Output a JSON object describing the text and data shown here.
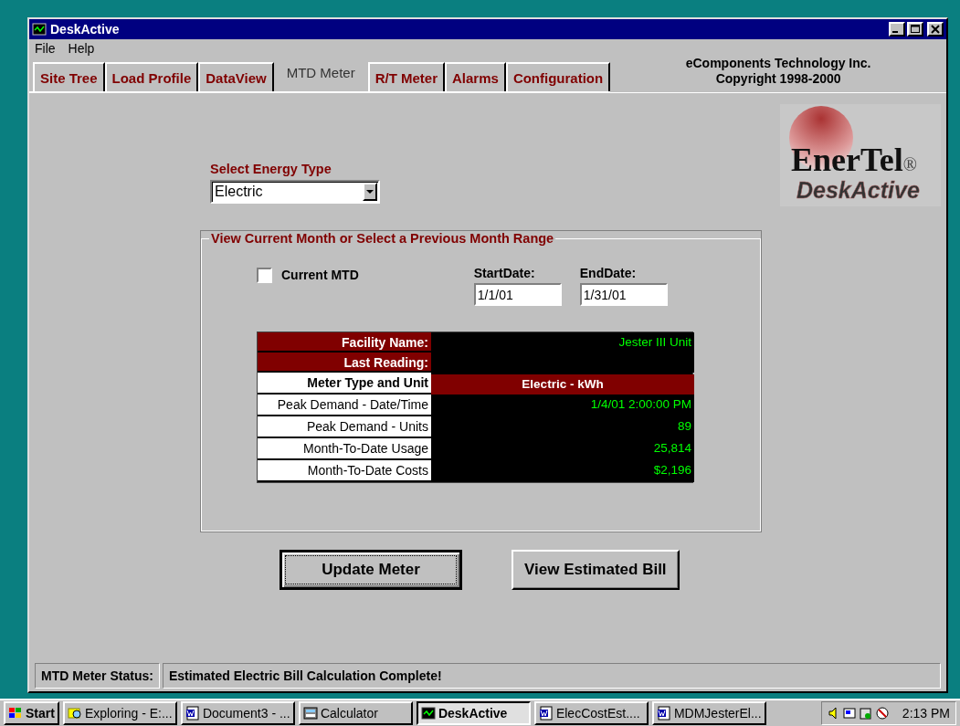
{
  "window": {
    "title": "DeskActive"
  },
  "menu": [
    "File",
    "Help"
  ],
  "tabs": [
    {
      "label": "Site Tree",
      "selected": false
    },
    {
      "label": "Load Profile",
      "selected": false
    },
    {
      "label": "DataView",
      "selected": false
    },
    {
      "label": "MTD Meter",
      "selected": true
    },
    {
      "label": "R/T Meter",
      "selected": false
    },
    {
      "label": "Alarms",
      "selected": false
    },
    {
      "label": "Configuration",
      "selected": false
    }
  ],
  "company": [
    "eComponents Technology Inc.",
    "Copyright 1998-2000"
  ],
  "logo": {
    "name": "EnerTel",
    "mark": "®",
    "product": "DeskActive"
  },
  "energy_type": {
    "label": "Select Energy Type",
    "value": "Electric"
  },
  "range": {
    "title": "View Current Month or Select a Previous Month Range",
    "current_mtd": {
      "label": "Current MTD",
      "checked": false
    },
    "start_date": {
      "label": "StartDate:",
      "value": "1/1/01"
    },
    "end_date": {
      "label": "EndDate:",
      "value": "1/31/01"
    }
  },
  "table": [
    {
      "kind": "header",
      "label": "Facility Name:",
      "value": "Jester III Unit"
    },
    {
      "kind": "header",
      "label": "Last Reading:"
    },
    {
      "kind": "type",
      "label": "Meter Type and Unit",
      "value": "Electric - kWh"
    },
    {
      "kind": "plain",
      "label": "Peak Demand - Date/Time",
      "value": "1/4/01 2:00:00 PM"
    },
    {
      "kind": "plain",
      "label": "Peak Demand - Units",
      "value": "89"
    },
    {
      "kind": "plain",
      "label": "Month-To-Date Usage",
      "value": "25,814"
    },
    {
      "kind": "plain",
      "label": "Month-To-Date Costs",
      "value": "$2,196"
    }
  ],
  "buttons": [
    {
      "label": "Update Meter",
      "focused": true
    },
    {
      "label": "View Estimated Bill",
      "focused": false
    }
  ],
  "status_bar": {
    "label": "MTD Meter Status:",
    "message": "Estimated Electric Bill Calculation Complete!"
  },
  "taskbar": {
    "start": "Start",
    "tasks": [
      {
        "label": "Exploring - E:...",
        "selected": false
      },
      {
        "label": "Document3 - ...",
        "selected": false
      },
      {
        "label": "Calculator",
        "selected": false
      },
      {
        "label": "DeskActive",
        "selected": true
      },
      {
        "label": "ElecCostEst....",
        "selected": false
      },
      {
        "label": "MDMJesterEl...",
        "selected": false
      }
    ],
    "time": "2:13 PM"
  }
}
